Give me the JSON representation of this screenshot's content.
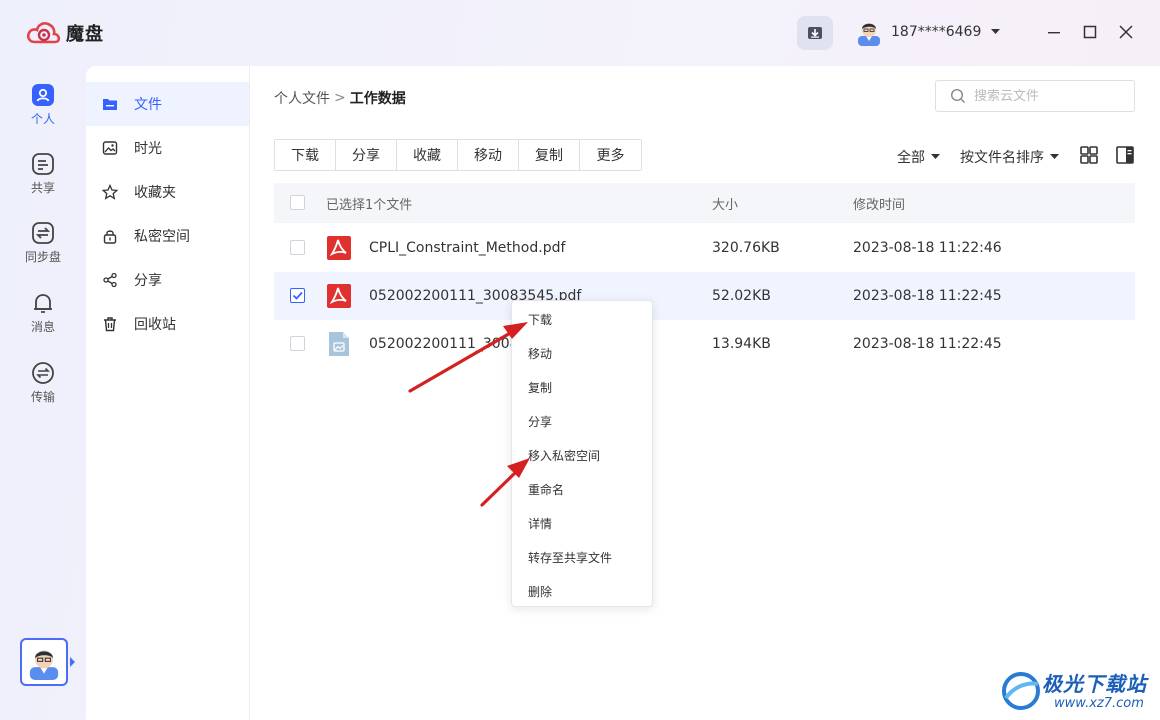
{
  "app": {
    "title": "魔盘",
    "brand_color": "#3761ff"
  },
  "header": {
    "user_name": "187****6469",
    "download_icon": "download-tray-icon"
  },
  "rail": {
    "items": [
      {
        "label": "个人",
        "icon": "person-icon",
        "active": true
      },
      {
        "label": "共享",
        "icon": "share-folder-icon",
        "active": false
      },
      {
        "label": "同步盘",
        "icon": "sync-icon",
        "active": false
      },
      {
        "label": "消息",
        "icon": "bell-icon",
        "active": false
      },
      {
        "label": "传输",
        "icon": "transfer-icon",
        "active": false
      }
    ]
  },
  "sidenav": {
    "items": [
      {
        "label": "文件",
        "icon": "folder-icon",
        "active": true
      },
      {
        "label": "时光",
        "icon": "image-icon",
        "active": false
      },
      {
        "label": "收藏夹",
        "icon": "star-icon",
        "active": false
      },
      {
        "label": "私密空间",
        "icon": "lock-icon",
        "active": false
      },
      {
        "label": "分享",
        "icon": "share-icon",
        "active": false
      },
      {
        "label": "回收站",
        "icon": "trash-icon",
        "active": false
      }
    ]
  },
  "breadcrumb": {
    "parent": "个人文件",
    "separator": ">",
    "current": "工作数据"
  },
  "search": {
    "placeholder": "搜索云文件"
  },
  "toolbar": {
    "buttons": [
      "下载",
      "分享",
      "收藏",
      "移动",
      "复制",
      "更多"
    ]
  },
  "filters": {
    "scope": "全部",
    "sort": "按文件名排序"
  },
  "table": {
    "header": {
      "selection_text": "已选择1个文件",
      "size": "大小",
      "modified": "修改时间"
    },
    "rows": [
      {
        "name": "CPLI_Constraint_Method.pdf",
        "size": "320.76KB",
        "modified": "2023-08-18 11:22:46",
        "type": "pdf",
        "checked": false
      },
      {
        "name": "052002200111_30083545.pdf",
        "size": "52.02KB",
        "modified": "2023-08-18 11:22:45",
        "type": "pdf",
        "checked": true
      },
      {
        "name": "052002200111_3008",
        "size": "13.94KB",
        "modified": "2023-08-18 11:22:45",
        "type": "image",
        "checked": false
      }
    ]
  },
  "context_menu": {
    "items": [
      "下载",
      "移动",
      "复制",
      "分享",
      "移入私密空间",
      "重命名",
      "详情",
      "转存至共享文件",
      "删除"
    ]
  },
  "watermark": {
    "main": "极光下载站",
    "sub": "www.xz7.com"
  }
}
